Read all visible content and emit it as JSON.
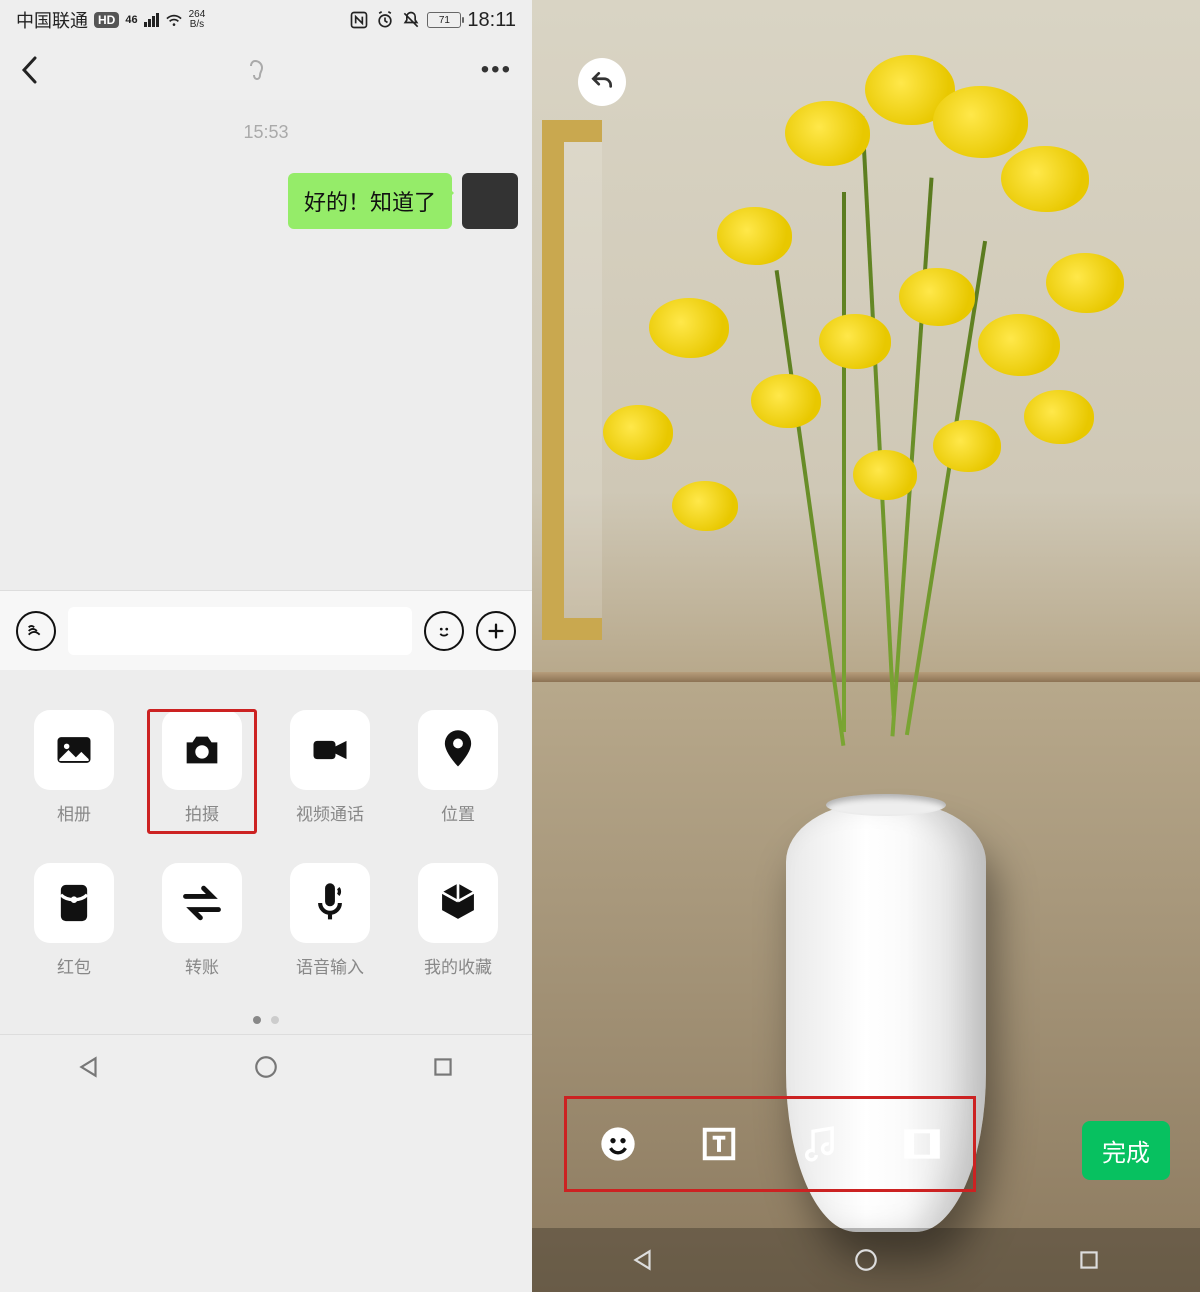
{
  "status": {
    "carrier": "中国联通",
    "hd": "HD",
    "net_gen": "46",
    "speed_num": "264",
    "speed_unit": "B/s",
    "battery_pct": "71",
    "time": "18:11"
  },
  "chat": {
    "timestamp": "15:53",
    "message_text": "好的！知道了"
  },
  "attach": {
    "items": [
      {
        "label": "相册",
        "icon": "image"
      },
      {
        "label": "拍摄",
        "icon": "camera"
      },
      {
        "label": "视频通话",
        "icon": "video"
      },
      {
        "label": "位置",
        "icon": "location"
      },
      {
        "label": "红包",
        "icon": "redpacket"
      },
      {
        "label": "转账",
        "icon": "transfer"
      },
      {
        "label": "语音输入",
        "icon": "mic"
      },
      {
        "label": "我的收藏",
        "icon": "cube"
      }
    ],
    "highlighted_index": 1
  },
  "editor": {
    "done_label": "完成",
    "tools": [
      "emoji",
      "text",
      "music",
      "crop"
    ]
  }
}
